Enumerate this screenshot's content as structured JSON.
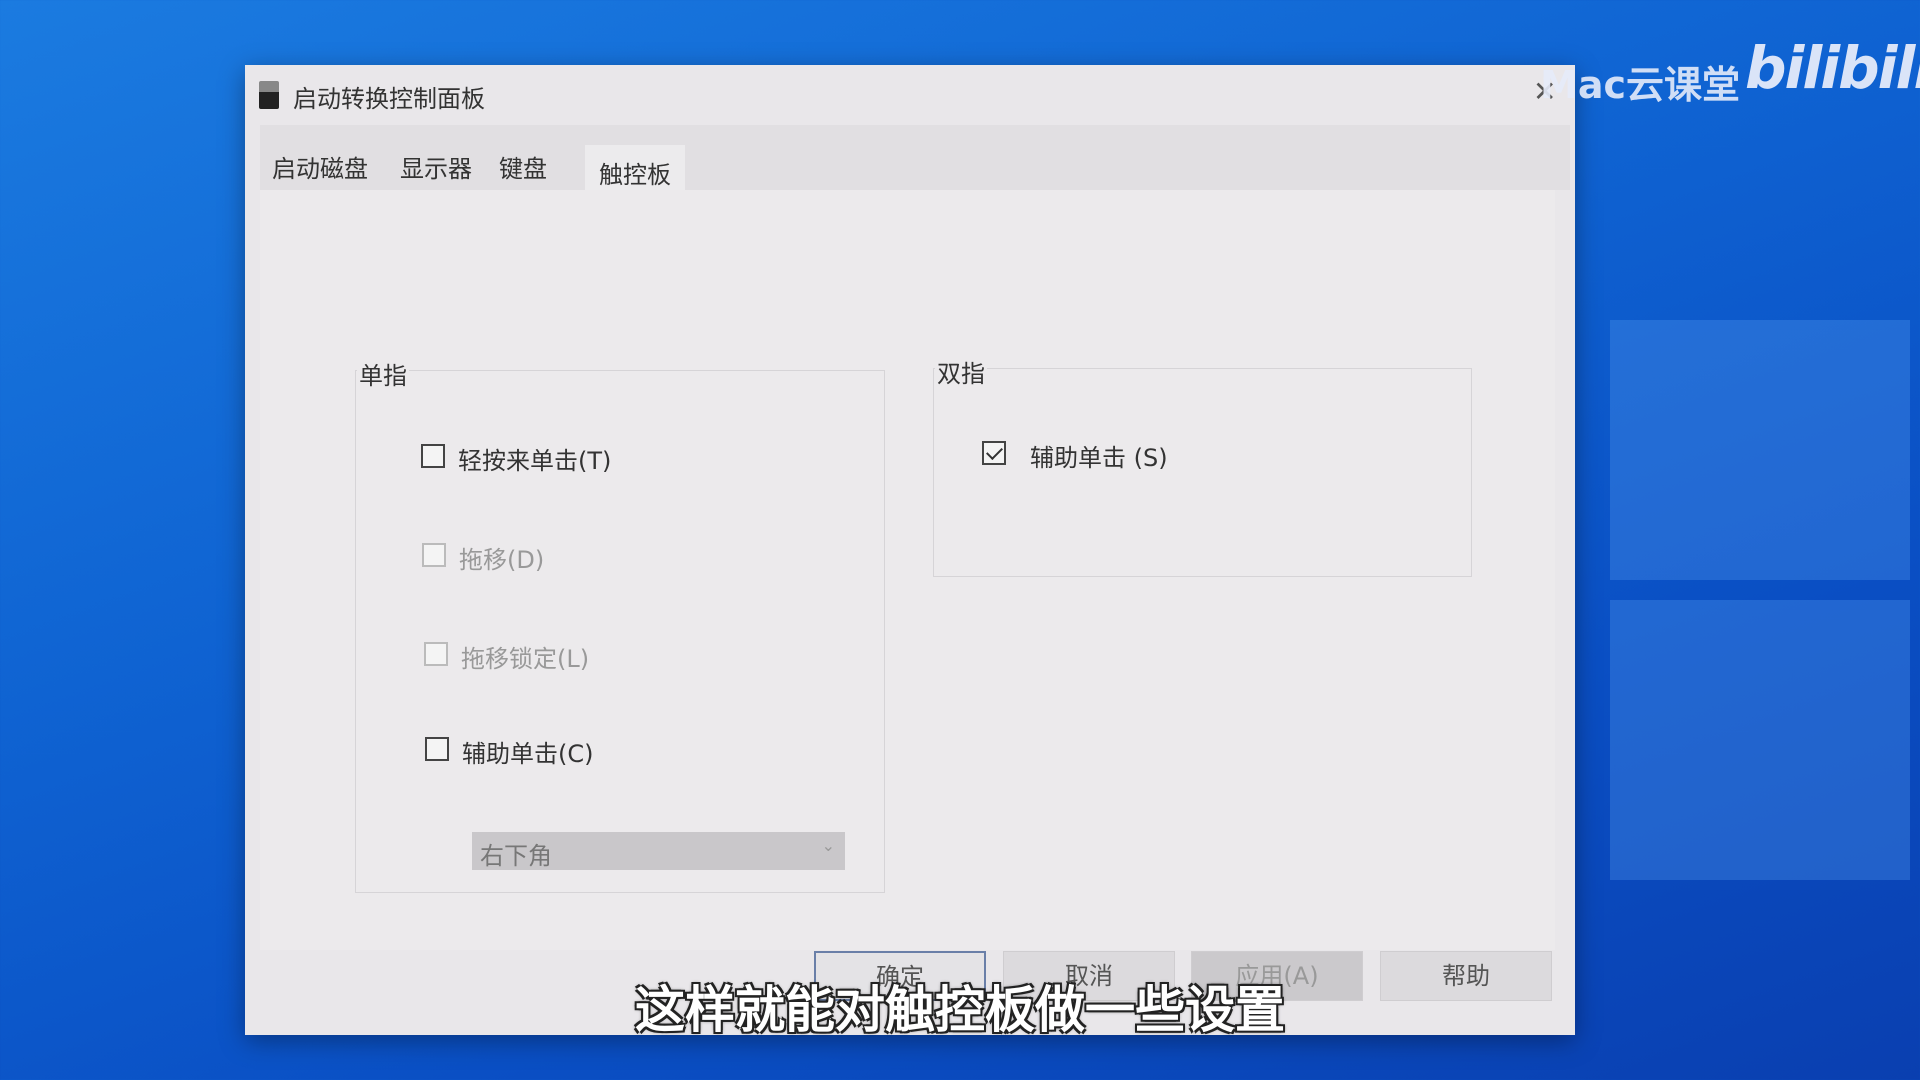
{
  "window": {
    "title": "启动转换控制面板",
    "close_icon": "close-icon"
  },
  "tabs": [
    {
      "label": "启动磁盘"
    },
    {
      "label": "显示器"
    },
    {
      "label": "键盘"
    },
    {
      "label": "触控板",
      "selected": true
    }
  ],
  "single_finger": {
    "label": "单指",
    "options": [
      {
        "label": "轻按来单击(T)",
        "checked": false,
        "enabled": true
      },
      {
        "label": "拖移(D)",
        "checked": false,
        "enabled": false
      },
      {
        "label": "拖移锁定(L)",
        "checked": false,
        "enabled": false
      },
      {
        "label": "辅助单击(C)",
        "checked": false,
        "enabled": true
      }
    ],
    "corner_select": {
      "value": "右下角",
      "enabled": false
    }
  },
  "two_finger": {
    "label": "双指",
    "options": [
      {
        "label": "辅助单击 (S)",
        "checked": true,
        "enabled": true
      }
    ]
  },
  "buttons": {
    "ok": "确定",
    "cancel": "取消",
    "apply": "应用(A)",
    "help": "帮助"
  },
  "subtitle": "这样就能对触控板做一些设置",
  "watermark": {
    "channel": "Mac云课堂",
    "logo": "bilibili"
  }
}
